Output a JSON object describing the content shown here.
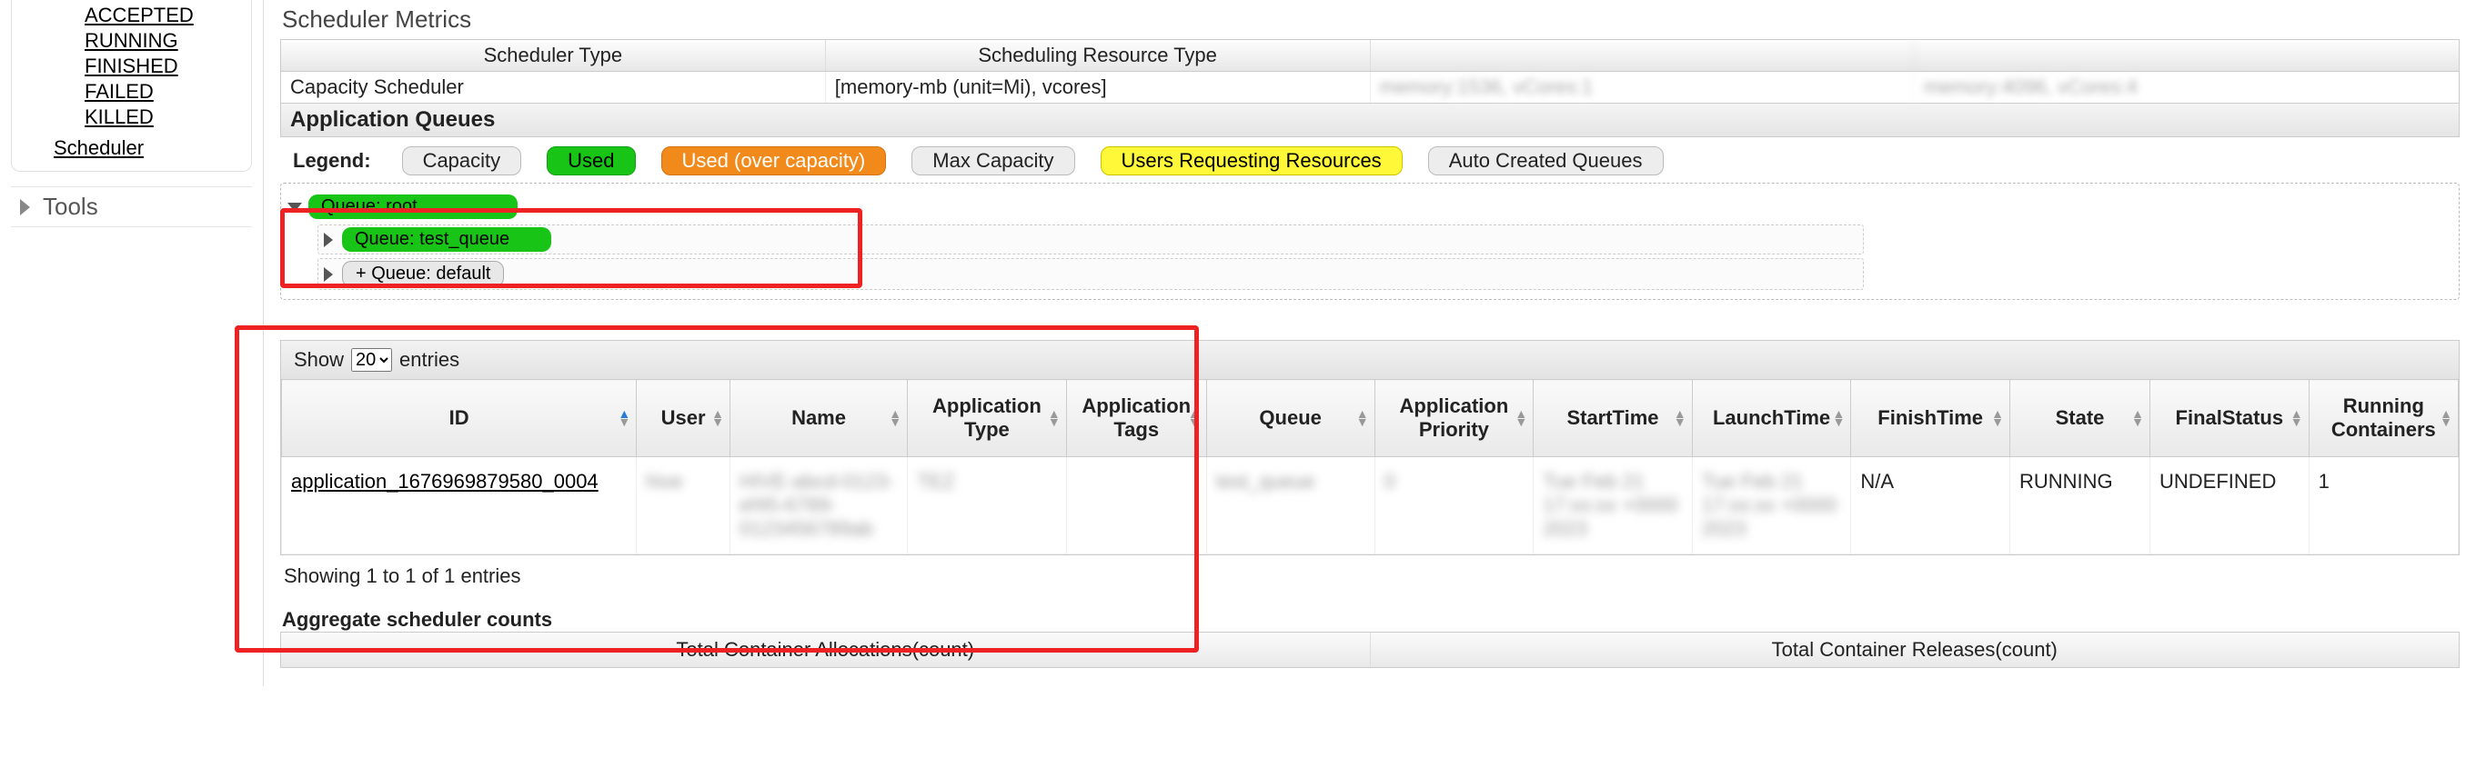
{
  "sidebar": {
    "states": [
      "ACCEPTED",
      "RUNNING",
      "FINISHED",
      "FAILED",
      "KILLED"
    ],
    "scheduler_link": "Scheduler",
    "tools": "Tools"
  },
  "metrics": {
    "title": "Scheduler Metrics",
    "columns": [
      "Scheduler Type",
      "Scheduling Resource Type",
      "",
      ""
    ],
    "row": {
      "type": "Capacity Scheduler",
      "resource": "[memory-mb (unit=Mi), vcores]",
      "c3": "memory:1536, vCores:1",
      "c4": "memory:4096, vCores:4"
    }
  },
  "queues": {
    "title": "Application Queues",
    "legend_label": "Legend:",
    "legend": {
      "capacity": "Capacity",
      "used": "Used",
      "used_over": "Used (over capacity)",
      "max": "Max Capacity",
      "users": "Users Requesting Resources",
      "auto": "Auto Created Queues"
    },
    "root": "Queue: root",
    "children": [
      {
        "label": "Queue: test_queue",
        "kind": "green"
      },
      {
        "label": "+ Queue: default",
        "kind": "plus"
      }
    ]
  },
  "apps": {
    "show_label_pre": "Show",
    "show_label_post": "entries",
    "page_size": "20",
    "columns": [
      "ID",
      "User",
      "Name",
      "Application Type",
      "Application Tags",
      "Queue",
      "Application Priority",
      "StartTime",
      "LaunchTime",
      "FinishTime",
      "State",
      "FinalStatus",
      "Running Containers"
    ],
    "row": {
      "id": "application_1676969879580_0004",
      "user": "hive",
      "name": "HIVE-abcd-0123-ef45-6789-0123456789ab",
      "type": "TEZ",
      "tags": "",
      "queue": "test_queue",
      "priority": "0",
      "start": "Tue Feb 21 17:xx:xx +0000 2023",
      "launch": "Tue Feb 21 17:xx:xx +0000 2023",
      "finish": "N/A",
      "state": "RUNNING",
      "final": "UNDEFINED",
      "running": "1"
    },
    "info": "Showing 1 to 1 of 1 entries"
  },
  "aggregate": {
    "title": "Aggregate scheduler counts",
    "columns": [
      "Total Container Allocations(count)",
      "Total Container Releases(count)"
    ]
  }
}
